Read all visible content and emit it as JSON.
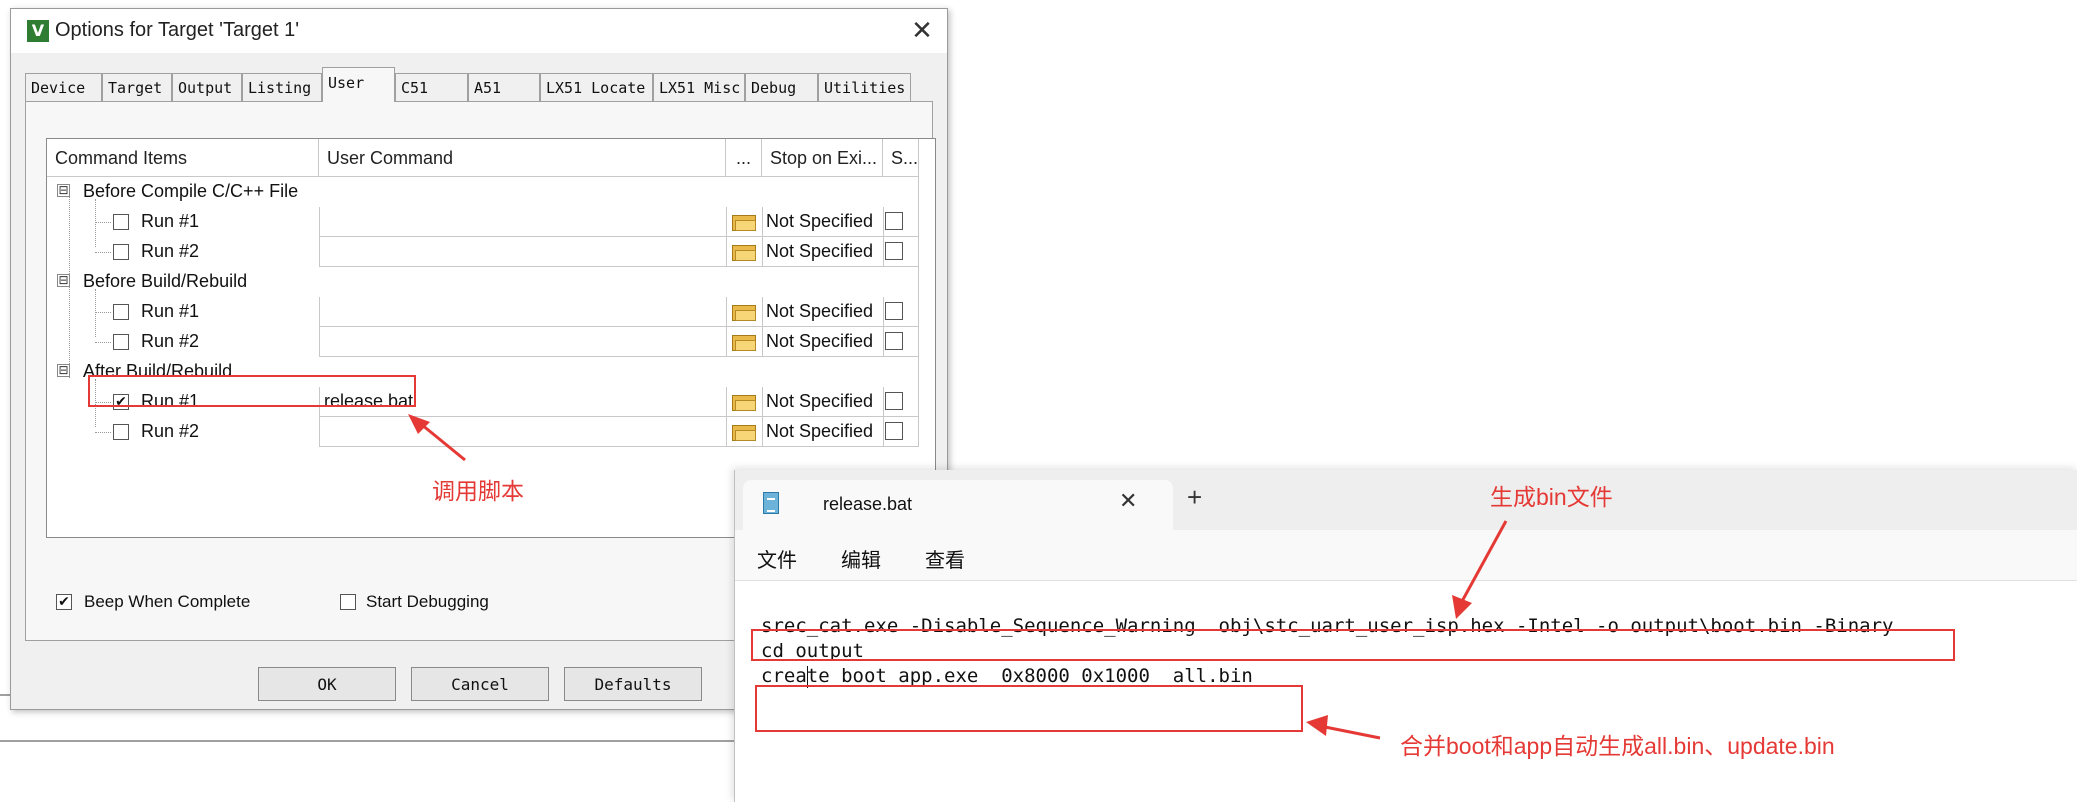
{
  "dialog": {
    "title": "Options for Target 'Target 1'",
    "tabs": [
      "Device",
      "Target",
      "Output",
      "Listing",
      "User",
      "C51",
      "A51",
      "LX51 Locate",
      "LX51 Misc",
      "Debug",
      "Utilities"
    ],
    "active_tab": "User",
    "columns": {
      "command_items": "Command Items",
      "user_command": "User Command",
      "browse": "...",
      "stop_on_exit": "Stop on Exi...",
      "s": "S..."
    },
    "groups": [
      {
        "label": "Before Compile C/C++ File",
        "runs": [
          {
            "label": "Run #1",
            "checked": false,
            "command": "",
            "stop": "Not Specified"
          },
          {
            "label": "Run #2",
            "checked": false,
            "command": "",
            "stop": "Not Specified"
          }
        ]
      },
      {
        "label": "Before Build/Rebuild",
        "runs": [
          {
            "label": "Run #1",
            "checked": false,
            "command": "",
            "stop": "Not Specified"
          },
          {
            "label": "Run #2",
            "checked": false,
            "command": "",
            "stop": "Not Specified"
          }
        ]
      },
      {
        "label": "After Build/Rebuild",
        "runs": [
          {
            "label": "Run #1",
            "checked": true,
            "command": "release.bat",
            "stop": "Not Specified"
          },
          {
            "label": "Run #2",
            "checked": false,
            "command": "",
            "stop": "Not Specified"
          }
        ]
      }
    ],
    "expander_symbol": "⊟",
    "check_mark": "✔",
    "options": {
      "beep_label": "Beep When Complete",
      "beep_checked": true,
      "start_debug_label": "Start Debugging",
      "start_debug_checked": false
    },
    "buttons": {
      "ok": "OK",
      "cancel": "Cancel",
      "defaults": "Defaults"
    },
    "close_symbol": "✕",
    "app_icon_letter": "V"
  },
  "annotations": {
    "call_script": "调用脚本",
    "generate_bin": "生成bin文件",
    "merge": "合并boot和app自动生成all.bin、update.bin",
    "color": "#e53935"
  },
  "notepad": {
    "tab_title": "release.bat",
    "close_symbol": "✕",
    "new_tab_symbol": "+",
    "menu": [
      "文件",
      "编辑",
      "查看"
    ],
    "lines": [
      "srec_cat.exe -Disable_Sequence_Warning  obj\\stc_uart_user_isp.hex -Intel -o output\\boot.bin -Binary",
      "cd output",
      "create_boot_app.exe  0x8000 0x1000  all.bin"
    ]
  },
  "icons": {
    "app": "keil-app-icon",
    "close": "close-icon",
    "folder": "folder-open-icon",
    "notepad": "notepad-icon",
    "plus": "plus-icon"
  }
}
